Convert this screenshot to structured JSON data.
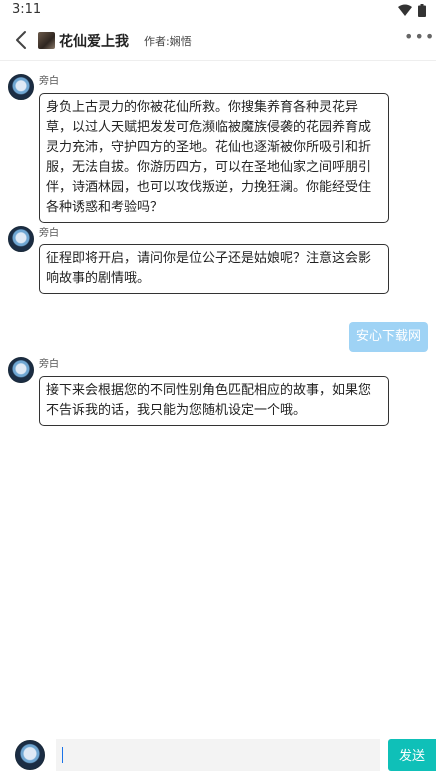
{
  "status_bar": {
    "time": "3:11"
  },
  "header": {
    "title": "花仙爱上我",
    "author": "作者:娴悟"
  },
  "messages": [
    {
      "speaker": "旁白",
      "text": "身负上古灵力的你被花仙所救。你搜集养育各种灵花异草，以过人天赋把发发可危濒临被魔族侵袭的花园养育成灵力充沛，守护四方的圣地。花仙也逐渐被你所吸引和折服，无法自拔。你游历四方，可以在圣地仙家之间呼朋引伴，诗酒林园，也可以攻伐叛逆，力挽狂澜。你能经受住各种诱惑和考验吗？"
    },
    {
      "speaker": "旁白",
      "text": "征程即将开启，请问你是位公子还是姑娘呢？注意这会影响故事的剧情哦。"
    },
    {
      "speaker": "user",
      "text": "安心下载网"
    },
    {
      "speaker": "旁白",
      "text": "接下来会根据您的不同性别角色匹配相应的故事，如果您不告诉我的话，我只能为您随机设定一个哦。"
    }
  ],
  "input": {
    "value": "",
    "send_label": "发送"
  }
}
